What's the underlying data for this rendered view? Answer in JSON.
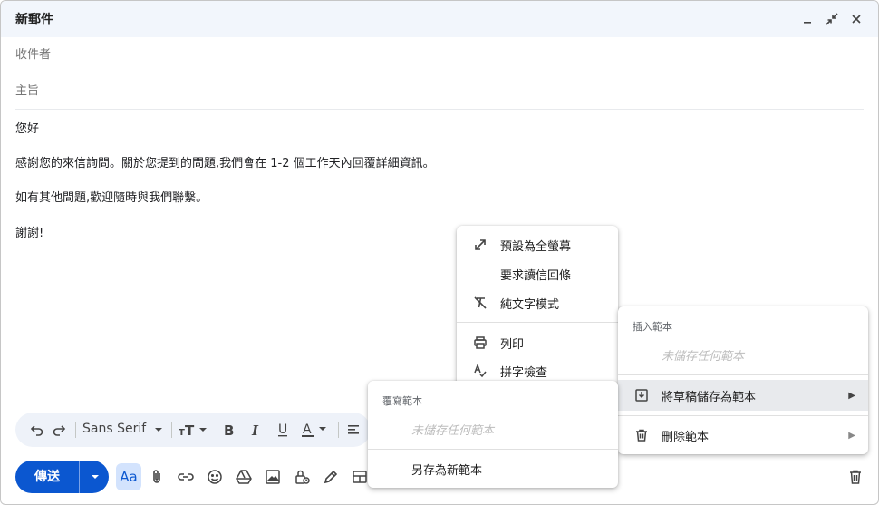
{
  "window": {
    "title": "新郵件"
  },
  "fields": {
    "to_placeholder": "收件者",
    "subject_placeholder": "主旨"
  },
  "body": {
    "lines": [
      "您好",
      "感謝您的來信詢問。關於您提到的問題,我們會在 1-2 個工作天內回覆詳細資訊。",
      "如有其他問題,歡迎隨時與我們聯繫。",
      "謝謝!"
    ]
  },
  "format_toolbar": {
    "font": "Sans Serif"
  },
  "send": {
    "label": "傳送"
  },
  "bottom_bar": {
    "format_toggle": "Aa"
  },
  "more_menu": {
    "items": [
      {
        "label": "預設為全螢幕",
        "icon": "expand-icon"
      },
      {
        "label": "要求讀信回條",
        "icon": ""
      },
      {
        "label": "純文字模式",
        "icon": "plain-text-icon"
      },
      {
        "label": "列印",
        "icon": "print-icon"
      },
      {
        "label": "拼字檢查",
        "icon": "spellcheck-icon"
      }
    ]
  },
  "templates_menu": {
    "insert_header": "插入範本",
    "insert_empty": "未儲存任何範本",
    "save_draft": "將草稿儲存為範本",
    "delete": "刪除範本"
  },
  "overwrite_menu": {
    "header": "覆寫範本",
    "empty": "未儲存任何範本",
    "save_new": "另存為新範本"
  },
  "colors": {
    "accent": "#0b57d0",
    "title_bar": "#f2f6fc",
    "selected_menu_item": "#e8eaed"
  }
}
